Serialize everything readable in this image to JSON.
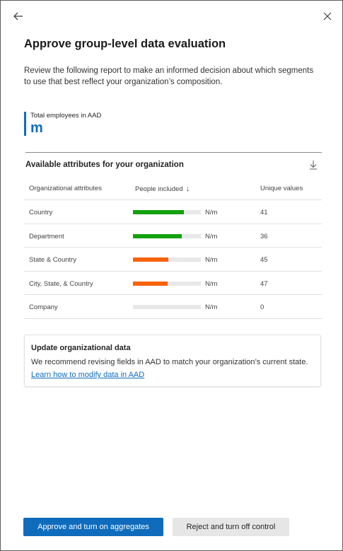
{
  "panel": {
    "title": "Approve group-level data evaluation",
    "description": "Review the following report to make an informed decision about which segments to use that best reflect your organization’s composition."
  },
  "kpi": {
    "label": "Total employees in AAD",
    "value": "m"
  },
  "section": {
    "title": "Available attributes for your organization"
  },
  "table": {
    "headers": {
      "attribute": "Organizational attributes",
      "people": "People included",
      "unique": "Unique values"
    },
    "rows": [
      {
        "attribute": "Country",
        "people": "N/m",
        "fill": 0.75,
        "color": "#13a10e",
        "unique": "41"
      },
      {
        "attribute": "Department",
        "people": "N/m",
        "fill": 0.72,
        "color": "#13a10e",
        "unique": "36"
      },
      {
        "attribute": "State & Country",
        "people": "N/m",
        "fill": 0.52,
        "color": "#f7630c",
        "unique": "45"
      },
      {
        "attribute": "City, State, & Country",
        "people": "N/m",
        "fill": 0.51,
        "color": "#f7630c",
        "unique": "47"
      },
      {
        "attribute": "Company",
        "people": "N/m",
        "fill": 0,
        "color": "#e8e8e8",
        "unique": "0"
      }
    ]
  },
  "card": {
    "title": "Update organizational data",
    "text": "We recommend revising fields in AAD to match your organization’s current state.",
    "link": "Learn how to modify data in AAD"
  },
  "buttons": {
    "approve": "Approve and turn on aggregates",
    "reject": "Reject and turn off control"
  },
  "colors": {
    "accent": "#0f6cbd",
    "good": "#13a10e",
    "warning": "#f7630c"
  },
  "icons": {
    "back": "arrow-left-icon",
    "close": "close-icon",
    "download": "download-icon",
    "sort": "arrow-down-icon"
  }
}
